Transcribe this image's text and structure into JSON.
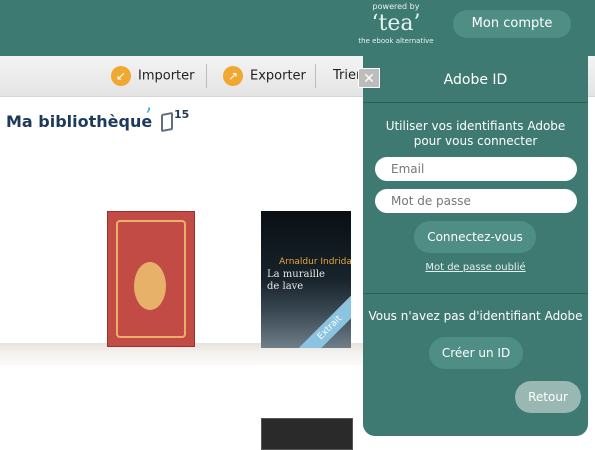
{
  "header": {
    "powered_by": "powered by",
    "brand": "‘tea’",
    "tagline": "the ebook alternative",
    "account_label": "Mon compte"
  },
  "toolbar": {
    "import_label": "Importer",
    "export_label": "Exporter",
    "sort_label": "Trier"
  },
  "library": {
    "title": "Ma bibliothèque",
    "count": "15",
    "books": [
      {
        "cover_text": ""
      },
      {
        "author": "Arnaldur Indridason",
        "title_line1": "La muraille",
        "title_line2": "de lave",
        "badge": "Extrait"
      },
      {
        "cover_text": ""
      }
    ]
  },
  "adobe_panel": {
    "close_label": "✕",
    "title": "Adobe ID",
    "description": "Utiliser vos identifiants Adobe pour vous connecter",
    "email_placeholder": "Email",
    "password_placeholder": "Mot de passe",
    "connect_label": "Connectez-vous",
    "forgot_label": "Mot de passe oublié",
    "no_id_text": "Vous n'avez pas d'identifiant Adobe",
    "create_label": "Créer un ID",
    "back_label": "Retour"
  },
  "colors": {
    "brand_teal": "#3d7a72",
    "button_teal": "#4f8e85",
    "accent_orange": "#f0a830",
    "title_navy": "#1d3a5c"
  }
}
